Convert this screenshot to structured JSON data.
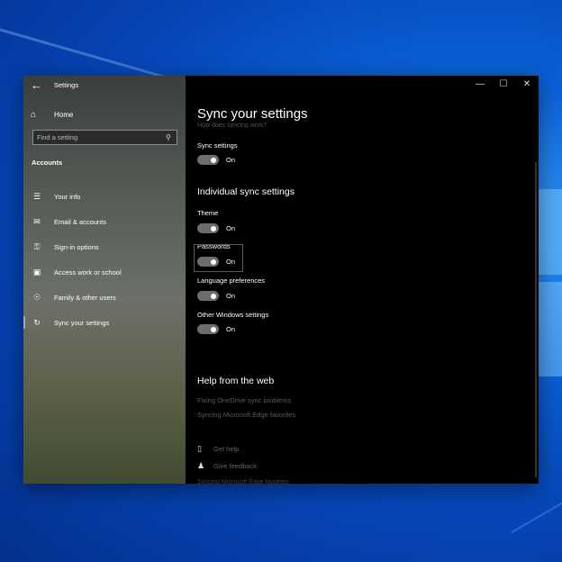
{
  "window": {
    "title": "Settings"
  },
  "window_controls": {
    "minimize": "—",
    "maximize": "☐",
    "close": "✕"
  },
  "sidebar": {
    "home_label": "Home",
    "search_placeholder": "Find a setting",
    "section": "Accounts",
    "items": [
      {
        "label": "Your info",
        "icon": "contact-card-icon"
      },
      {
        "label": "Email & accounts",
        "icon": "envelope-icon"
      },
      {
        "label": "Sign-in options",
        "icon": "key-icon"
      },
      {
        "label": "Access work or school",
        "icon": "briefcase-icon"
      },
      {
        "label": "Family & other users",
        "icon": "person-icon"
      },
      {
        "label": "Sync your settings",
        "icon": "sync-icon"
      }
    ]
  },
  "main": {
    "title": "Sync your settings",
    "faded_top": "How does syncing work?",
    "sync_settings": {
      "label": "Sync settings",
      "state": "On",
      "on": true
    },
    "individual_heading": "Individual sync settings",
    "toggles": [
      {
        "label": "Theme",
        "state": "On",
        "on": true
      },
      {
        "label": "Passwords",
        "state": "On",
        "on": true,
        "highlighted": true
      },
      {
        "label": "Language preferences",
        "state": "On",
        "on": true
      },
      {
        "label": "Other Windows settings",
        "state": "On",
        "on": true
      }
    ],
    "help_heading": "Help from the web",
    "help_links": [
      "Fixing OneDrive sync problems",
      "Syncing Microsoft Edge favorites"
    ],
    "actions": [
      {
        "label": "Get help",
        "icon": "chat-help-icon"
      },
      {
        "label": "Give feedback",
        "icon": "feedback-person-icon"
      }
    ],
    "clipped_bottom": "Syncing Microsoft Edge favorites"
  },
  "colors": {
    "highlight": "#e02020",
    "toggle_track": "#6d6d6d"
  }
}
